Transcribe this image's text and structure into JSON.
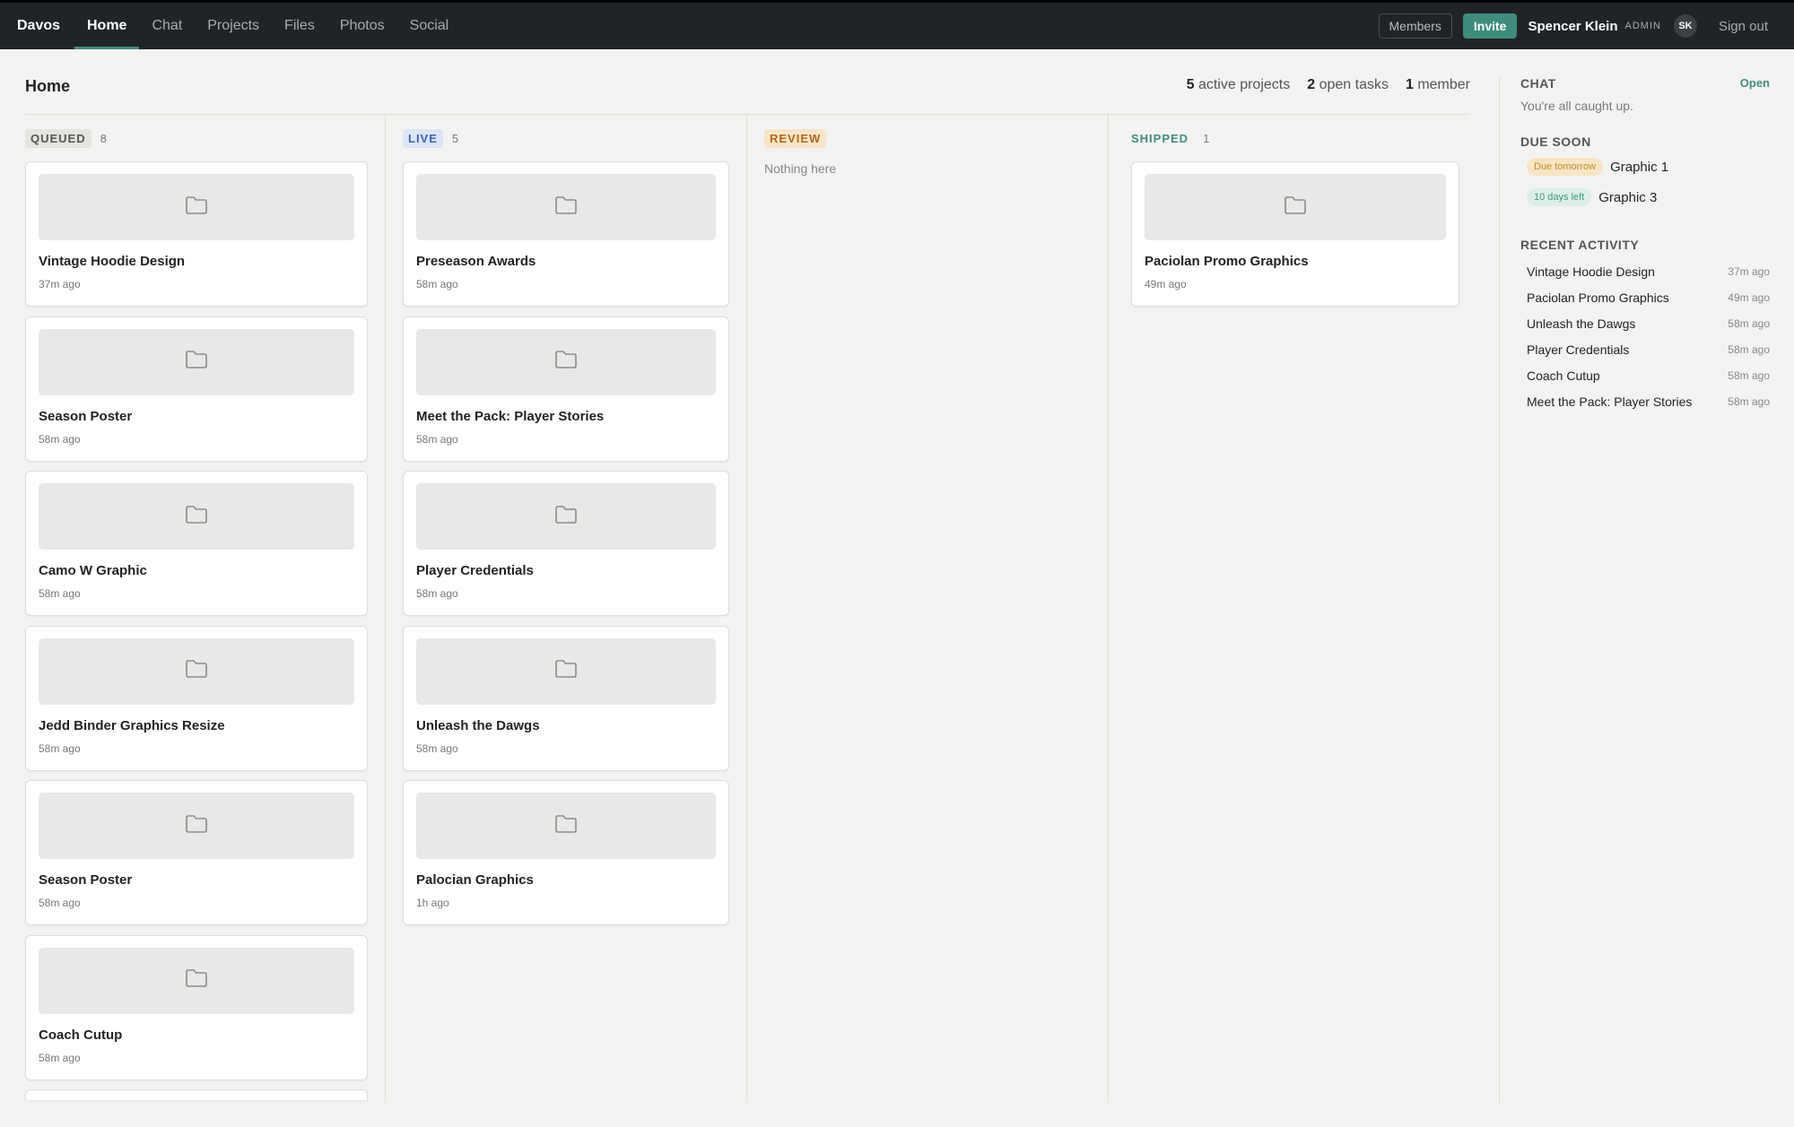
{
  "nav": {
    "brand": "Davos",
    "tabs": [
      "Home",
      "Chat",
      "Projects",
      "Files",
      "Photos",
      "Social"
    ],
    "members_label": "Members",
    "invite_label": "Invite",
    "user_name": "Spencer Klein",
    "user_role": "ADMIN",
    "avatar_initials": "SK",
    "signout_label": "Sign out"
  },
  "page": {
    "title": "Home",
    "stats": [
      {
        "num": "5",
        "label": " active projects"
      },
      {
        "num": "2",
        "label": " open tasks"
      },
      {
        "num": "1",
        "label": " member"
      }
    ]
  },
  "board": {
    "queued": {
      "label": "QUEUED",
      "count": "8",
      "cards": [
        {
          "title": "Vintage Hoodie Design",
          "time": "37m ago"
        },
        {
          "title": "Season Poster",
          "time": "58m ago"
        },
        {
          "title": "Camo W Graphic",
          "time": "58m ago"
        },
        {
          "title": "Jedd Binder Graphics Resize",
          "time": "58m ago"
        },
        {
          "title": "Season Poster",
          "time": "58m ago"
        },
        {
          "title": "Coach Cutup",
          "time": "58m ago"
        }
      ]
    },
    "live": {
      "label": "LIVE",
      "count": "5",
      "cards": [
        {
          "title": "Preseason Awards",
          "time": "58m ago"
        },
        {
          "title": "Meet the Pack: Player Stories",
          "time": "58m ago"
        },
        {
          "title": "Player Credentials",
          "time": "58m ago"
        },
        {
          "title": "Unleash the Dawgs",
          "time": "58m ago"
        },
        {
          "title": "Palocian Graphics",
          "time": "1h ago"
        }
      ]
    },
    "review": {
      "label": "REVIEW",
      "empty_text": "Nothing here"
    },
    "shipped": {
      "label": "SHIPPED",
      "count": "1",
      "cards": [
        {
          "title": "Paciolan Promo Graphics",
          "time": "49m ago"
        }
      ]
    }
  },
  "right": {
    "chat_heading": "CHAT",
    "chat_open": "Open",
    "chat_status": "You're all caught up.",
    "due_heading": "DUE SOON",
    "due": [
      {
        "pill": "Due tomorrow",
        "name": "Graphic 1",
        "kind": "warn"
      },
      {
        "pill": "10 days left",
        "name": "Graphic 3",
        "kind": "ok"
      }
    ],
    "activity_heading": "RECENT ACTIVITY",
    "activity": [
      {
        "name": "Vintage Hoodie Design",
        "time": "37m ago"
      },
      {
        "name": "Paciolan Promo Graphics",
        "time": "49m ago"
      },
      {
        "name": "Unleash the Dawgs",
        "time": "58m ago"
      },
      {
        "name": "Player Credentials",
        "time": "58m ago"
      },
      {
        "name": "Coach Cutup",
        "time": "58m ago"
      },
      {
        "name": "Meet the Pack: Player Stories",
        "time": "58m ago"
      }
    ]
  },
  "colors": {
    "topbar": "#202427",
    "accent": "#3f8c7e",
    "background": "#f3f3f1"
  }
}
